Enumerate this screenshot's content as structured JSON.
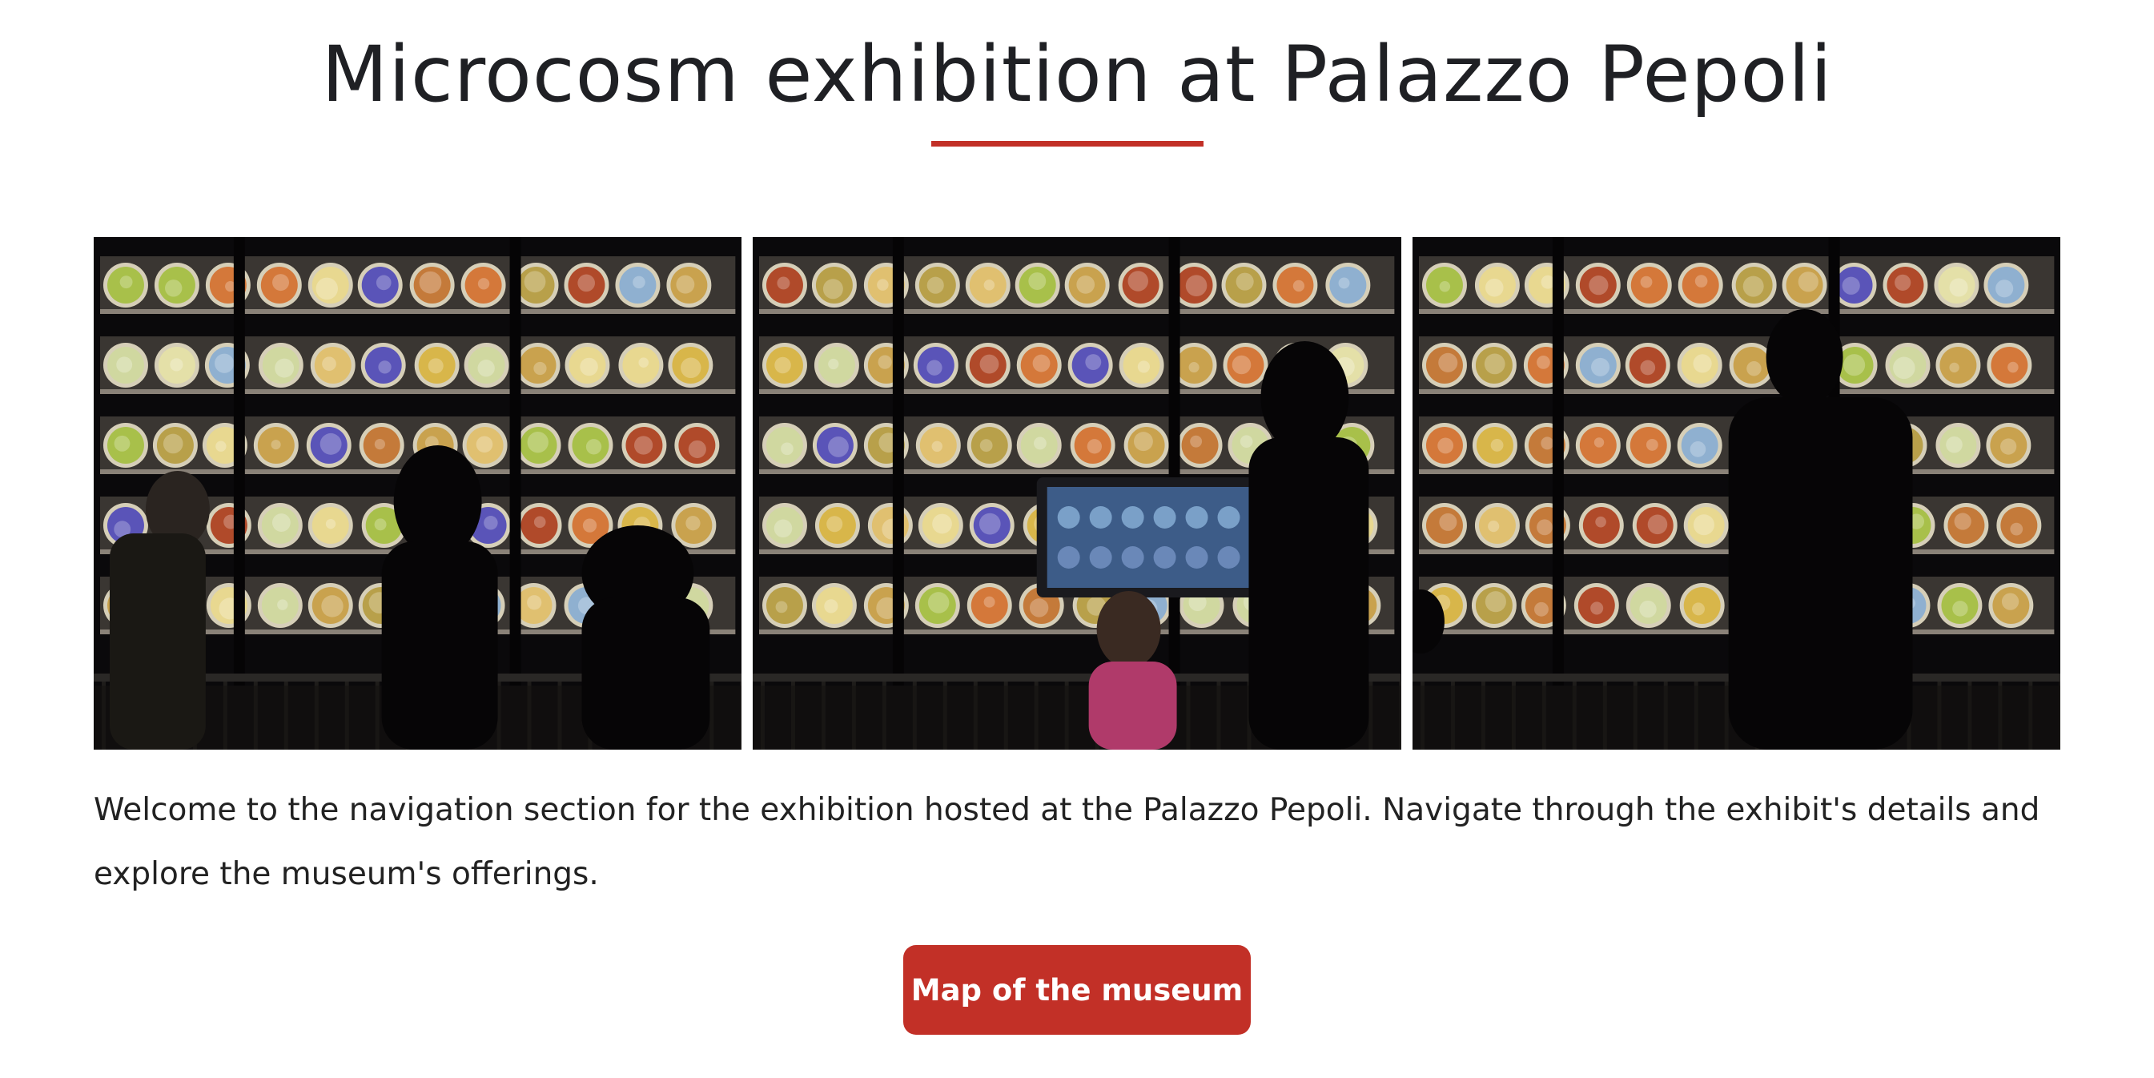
{
  "header": {
    "title": "Microcosm exhibition at Palazzo Pepoli"
  },
  "gallery": {
    "panels": [
      {
        "name": "exhibit-photo-left"
      },
      {
        "name": "exhibit-photo-center"
      },
      {
        "name": "exhibit-photo-right"
      }
    ]
  },
  "intro": {
    "text": "Welcome to the navigation section for the exhibition hosted at the Palazzo Pepoli. Navigate through the exhibit's details and explore the museum's offerings."
  },
  "actions": {
    "map_button_label": "Map of the museum"
  },
  "colors": {
    "accent": "#c23027",
    "title_text": "#1f2024",
    "background": "#ffffff"
  }
}
